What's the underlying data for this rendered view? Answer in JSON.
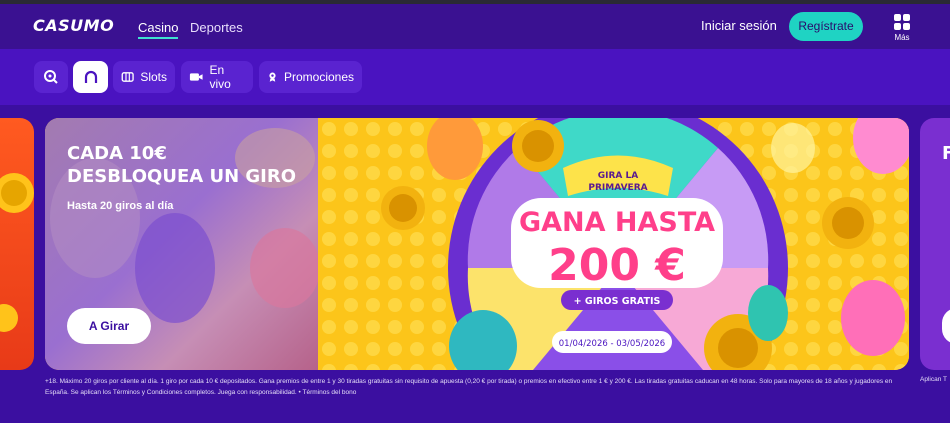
{
  "header": {
    "logo": "CASUMO",
    "nav": [
      {
        "label": "Casino",
        "active": true
      },
      {
        "label": "Deportes",
        "active": false
      }
    ],
    "login": "Iniciar sesión",
    "register": "Regístrate",
    "more_label": "Más"
  },
  "subnav": {
    "items": [
      {
        "label": "",
        "icon": "search-game-icon"
      },
      {
        "label": "",
        "icon": "home-icon",
        "active": true
      },
      {
        "label": "Slots",
        "icon": "slots-icon"
      },
      {
        "label": "En vivo",
        "icon": "video-camera-icon"
      },
      {
        "label": "Promociones",
        "icon": "gift-gear-icon"
      }
    ]
  },
  "banner": {
    "title": "CADA 10€ DESBLOQUEA UN GIRO",
    "subtitle": "Hasta 20 giros al día",
    "cta": "A Girar",
    "wheel_tag": "GIRA LA PRIMAVERA",
    "headline1": "GANA HASTA",
    "headline2": "200 €",
    "bonus": "+ GIROS GRATIS",
    "dates": "01/04/2026 - 03/05/2026"
  },
  "terms": "+18. Máximo 20 giros por cliente al día. 1 giro por cada 10 € depositados. Gana premios de entre 1 y 30 tiradas gratuitas sin requisito de apuesta (0,20 € por tirada) o premios en efectivo entre 1 € y 200 €. Las tiradas gratuitas caducan en 48 horas. Solo para mayores de 18 años y jugadores en España. Se aplican los Términos y Condiciones completos. Juega con responsabilidad. • Términos del bono",
  "terms_right": "Aplican T",
  "colors": {
    "bg": "#3b0fa0",
    "accent": "#1fd3c3",
    "banner_yellow": "#fcd12a",
    "headline_pink": "#ff3f8a"
  }
}
